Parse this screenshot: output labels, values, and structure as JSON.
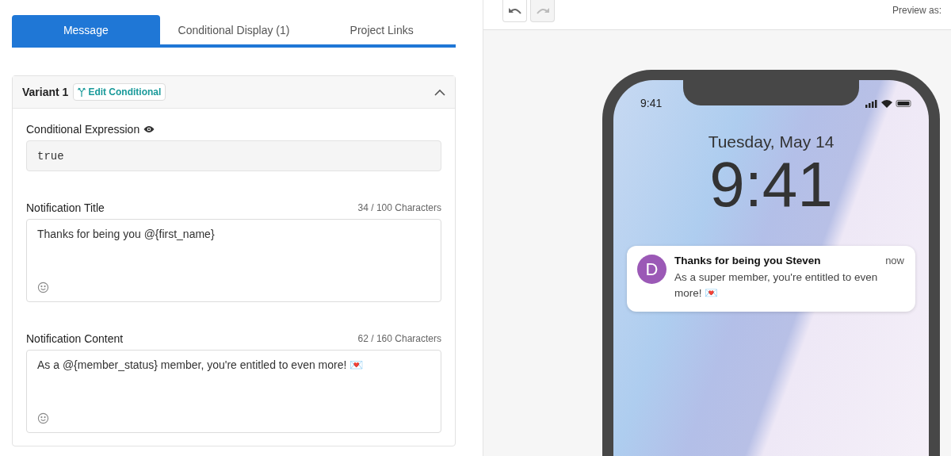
{
  "tabs": [
    {
      "label": "Message",
      "selected": true
    },
    {
      "label": "Conditional Display (1)",
      "selected": false
    },
    {
      "label": "Project Links",
      "selected": false
    }
  ],
  "variant": {
    "title": "Variant 1",
    "edit_button": "Edit Conditional",
    "expanded": true,
    "expression": {
      "label": "Conditional Expression",
      "value": "true"
    },
    "fields": [
      {
        "label": "Notification Title",
        "count": "34 / 100 Characters",
        "value": "Thanks for being you @{first_name}"
      },
      {
        "label": "Notification Content",
        "count": "62 / 160 Characters",
        "value": "As a @{member_status} member, you're entitled to even more! 💌"
      }
    ]
  },
  "toolbar": {
    "undo_disabled": false,
    "redo_disabled": true,
    "preview_label": "Preview as:"
  },
  "phone": {
    "status_time": "9:41",
    "date": "Tuesday, May 14",
    "time": "9:41",
    "notification": {
      "avatar": "D",
      "title": "Thanks for being you Steven",
      "time": "now",
      "body": "As a super member, you're entitled to even more! 💌"
    }
  }
}
